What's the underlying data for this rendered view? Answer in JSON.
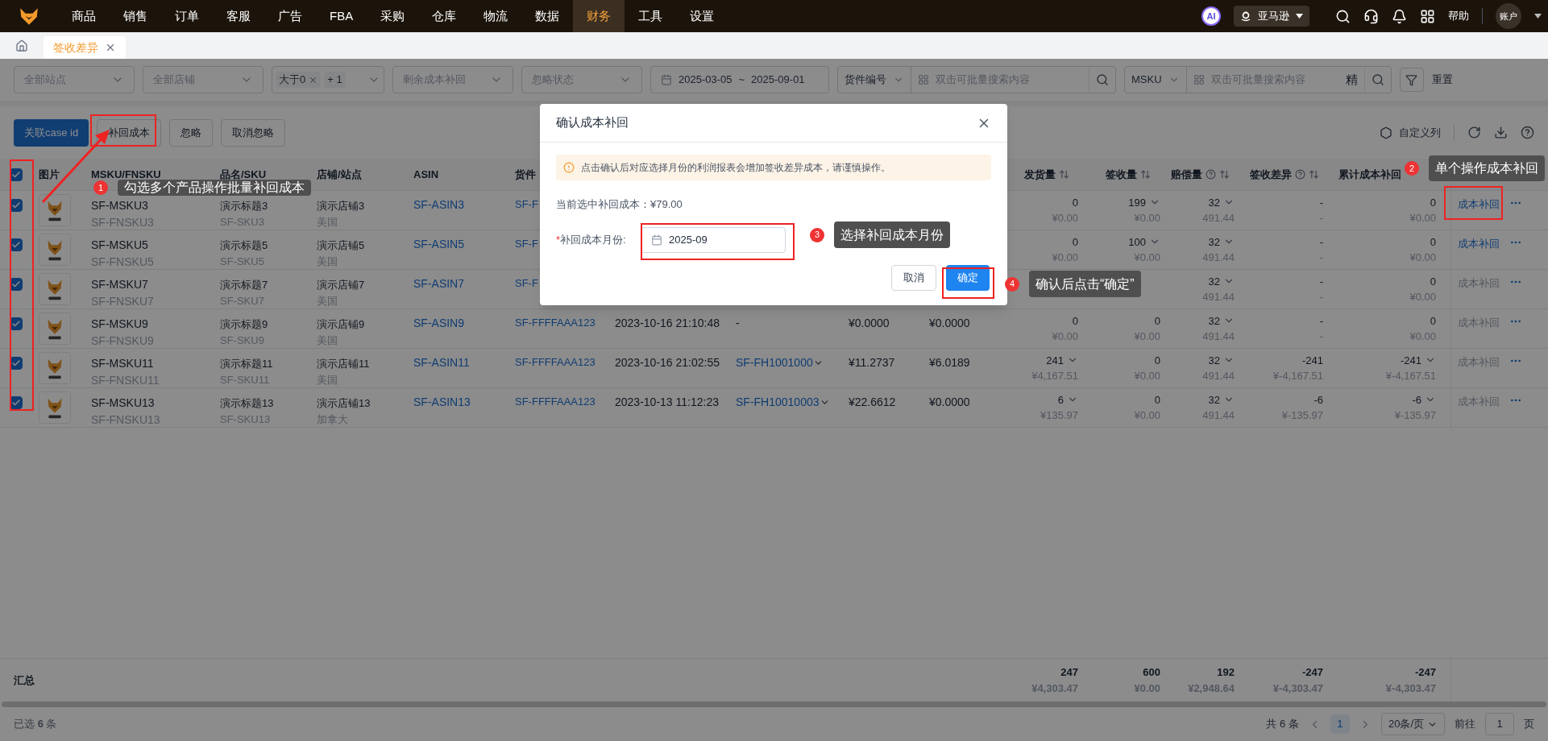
{
  "nav": {
    "items": [
      {
        "label": "商品",
        "selected": false
      },
      {
        "label": "销售",
        "selected": false
      },
      {
        "label": "订单",
        "selected": false
      },
      {
        "label": "客服",
        "selected": false
      },
      {
        "label": "广告",
        "selected": false
      },
      {
        "label": "FBA",
        "selected": false
      },
      {
        "label": "采购",
        "selected": false
      },
      {
        "label": "仓库",
        "selected": false
      },
      {
        "label": "物流",
        "selected": false
      },
      {
        "label": "数据",
        "selected": false
      },
      {
        "label": "财务",
        "selected": true
      },
      {
        "label": "工具",
        "selected": false
      },
      {
        "label": "设置",
        "selected": false
      }
    ],
    "ai_badge": "AI",
    "marketplace": "亚马逊",
    "help": "帮助",
    "account": "账户"
  },
  "tabs": [
    {
      "label": "签收差异",
      "selected": true
    }
  ],
  "filters": [
    {
      "kind": "select",
      "placeholder": "全部站点"
    },
    {
      "kind": "select",
      "placeholder": "全部店铺"
    },
    {
      "kind": "tags",
      "tags": [
        "大于0"
      ],
      "more": "+ 1"
    },
    {
      "kind": "select",
      "placeholder": "剩余成本补回"
    },
    {
      "kind": "select",
      "placeholder": "忽略状态"
    },
    {
      "kind": "daterange",
      "start": "2025-03-05",
      "separator": "~",
      "end": "2025-09-01"
    },
    {
      "kind": "search",
      "field": "货件编号",
      "placeholder": "双击可批量搜索内容"
    },
    {
      "kind": "search",
      "field": "MSKU",
      "placeholder": "双击可批量搜索内容",
      "exact": "精"
    }
  ],
  "reset": "重置",
  "toolbar": {
    "buttons": [
      {
        "label": "关联case id",
        "primary": true
      },
      {
        "label": "补回成本",
        "primary": false
      },
      {
        "label": "忽略",
        "primary": false
      },
      {
        "label": "取消忽略",
        "primary": false
      }
    ],
    "custom_columns": "自定义列"
  },
  "table": {
    "all_checked": true,
    "columns": [
      {
        "label": "图片"
      },
      {
        "label": "MSKU/FNSKU"
      },
      {
        "label": "品名/SKU"
      },
      {
        "label": "店铺/站点"
      },
      {
        "label": "ASIN"
      },
      {
        "label": "货件"
      }
    ],
    "number_columns": [
      {
        "label": "发货量",
        "icons": [
          {
            "kind": "sort"
          }
        ]
      },
      {
        "label": "签收量",
        "icons": [
          {
            "kind": "sort"
          }
        ]
      },
      {
        "label": "赔偿量",
        "icons": [
          {
            "kind": "help"
          },
          {
            "kind": "sort"
          }
        ]
      },
      {
        "label": "签收差异",
        "icons": [
          {
            "kind": "help"
          },
          {
            "kind": "sort"
          }
        ]
      },
      {
        "label": "累计成本补回"
      }
    ],
    "rows": [
      {
        "checked": true,
        "msku": "SF-MSKU3",
        "fnsku": "SF-FNSKU3",
        "title": "演示标题3",
        "sku": "SF-SKU3",
        "store": "演示店铺3",
        "site": "美国",
        "asin": "SF-ASIN3",
        "shipment_no": "SF-F",
        "shipped": {
          "value": "0",
          "amount": "¥0.00",
          "expandable": false
        },
        "received": {
          "value": "199",
          "amount": "¥0.00",
          "expandable": true
        },
        "compensation": {
          "value": "32",
          "amount": "491.44",
          "expandable": true
        },
        "difference": {
          "value": "-",
          "amount": "-",
          "expandable": false
        },
        "recovered": {
          "value": "0",
          "amount": "¥0.00",
          "expandable": false
        },
        "action": {
          "label": "成本补回",
          "disabled": false
        }
      },
      {
        "checked": true,
        "msku": "SF-MSKU5",
        "fnsku": "SF-FNSKU5",
        "title": "演示标题5",
        "sku": "SF-SKU5",
        "store": "演示店铺5",
        "site": "美国",
        "asin": "SF-ASIN5",
        "shipment_no": "SF-F",
        "shipped": {
          "value": "0",
          "amount": "¥0.00",
          "expandable": false
        },
        "received": {
          "value": "100",
          "amount": "¥0.00",
          "expandable": true
        },
        "compensation": {
          "value": "32",
          "amount": "491.44",
          "expandable": true
        },
        "difference": {
          "value": "-",
          "amount": "-",
          "expandable": false
        },
        "recovered": {
          "value": "0",
          "amount": "¥0.00",
          "expandable": false
        },
        "action": {
          "label": "成本补回",
          "disabled": false
        }
      },
      {
        "checked": true,
        "msku": "SF-MSKU7",
        "fnsku": "SF-FNSKU7",
        "title": "演示标题7",
        "sku": "SF-SKU7",
        "store": "演示店铺7",
        "site": "美国",
        "asin": "SF-ASIN7",
        "shipment_no": "SF-F",
        "compensation": {
          "value": "32",
          "amount": "491.44",
          "expandable": true
        },
        "difference": {
          "value": "-",
          "amount": "-",
          "expandable": false
        },
        "recovered": {
          "value": "0",
          "amount": "¥0.00",
          "expandable": false
        },
        "action": {
          "label": "成本补回",
          "disabled": true
        }
      },
      {
        "checked": true,
        "msku": "SF-MSKU9",
        "fnsku": "SF-FNSKU9",
        "title": "演示标题9",
        "sku": "SF-SKU9",
        "store": "演示店铺9",
        "site": "美国",
        "asin": "SF-ASIN9",
        "shipment_no": "SF-FFFFAAA123",
        "date": "2023-10-16 21:10:48",
        "shipment_id": {
          "text": "-",
          "expandable": false
        },
        "price_1": "¥0.0000",
        "price_2": "¥0.0000",
        "shipped": {
          "value": "0",
          "amount": "¥0.00",
          "expandable": false
        },
        "received": {
          "value": "0",
          "amount": "¥0.00",
          "expandable": false
        },
        "compensation": {
          "value": "32",
          "amount": "491.44",
          "expandable": true
        },
        "difference": {
          "value": "-",
          "amount": "-",
          "expandable": false
        },
        "recovered": {
          "value": "0",
          "amount": "¥0.00",
          "expandable": false
        },
        "action": {
          "label": "成本补回",
          "disabled": true
        }
      },
      {
        "checked": true,
        "msku": "SF-MSKU11",
        "fnsku": "SF-FNSKU11",
        "title": "演示标题11",
        "sku": "SF-SKU11",
        "store": "演示店铺11",
        "site": "美国",
        "asin": "SF-ASIN11",
        "shipment_no": "SF-FFFFAAA123",
        "date": "2023-10-16 21:02:55",
        "shipment_id": {
          "text": "SF-FH1001000",
          "expandable": true
        },
        "price_1": "¥11.2737",
        "price_2": "¥6.0189",
        "shipped": {
          "value": "241",
          "amount": "¥4,167.51",
          "expandable": true
        },
        "received": {
          "value": "0",
          "amount": "¥0.00",
          "expandable": false
        },
        "compensation": {
          "value": "32",
          "amount": "491.44",
          "expandable": true
        },
        "difference": {
          "value": "-241",
          "amount": "¥-4,167.51",
          "expandable": false
        },
        "recovered": {
          "value": "-241",
          "amount": "¥-4,167.51",
          "expandable": true
        },
        "action": {
          "label": "成本补回",
          "disabled": true
        }
      },
      {
        "checked": true,
        "msku": "SF-MSKU13",
        "fnsku": "SF-FNSKU13",
        "title": "演示标题13",
        "sku": "SF-SKU13",
        "store": "演示店铺13",
        "site": "加拿大",
        "asin": "SF-ASIN13",
        "shipment_no": "SF-FFFFAAA123",
        "date": "2023-10-13 11:12:23",
        "shipment_id": {
          "text": "SF-FH10010003",
          "expandable": true
        },
        "price_1": "¥22.6612",
        "price_2": "¥0.0000",
        "shipped": {
          "value": "6",
          "amount": "¥135.97",
          "expandable": true
        },
        "received": {
          "value": "0",
          "amount": "¥0.00",
          "expandable": false
        },
        "compensation": {
          "value": "32",
          "amount": "491.44",
          "expandable": true
        },
        "difference": {
          "value": "-6",
          "amount": "¥-135.97",
          "expandable": false
        },
        "recovered": {
          "value": "-6",
          "amount": "¥-135.97",
          "expandable": true
        },
        "action": {
          "label": "成本补回",
          "disabled": true
        }
      }
    ],
    "summary": {
      "label": "汇总",
      "cells": [
        {
          "value": "247",
          "amount": "¥4,303.47"
        },
        {
          "value": "600",
          "amount": "¥0.00"
        },
        {
          "value": "192",
          "amount": "¥2,948.64"
        },
        {
          "value": "-247",
          "amount": "¥-4,303.47"
        },
        {
          "value": "-247",
          "amount": "¥-4,303.47"
        }
      ]
    }
  },
  "footer": {
    "selected": "已选 **6** 条",
    "total": "共 6 条",
    "page": "1",
    "page_size": "20条/页",
    "goto": "前往",
    "goto_value": "1",
    "page_suffix": "页"
  },
  "modal": {
    "title": "确认成本补回",
    "notice": "点击确认后对应选择月份的利润报表会增加签收差异成本，请谨慎操作。",
    "current": "当前选中补回成本：¥79.00",
    "required_mark": "*",
    "field_label": "补回成本月份:",
    "field_value": "2025-09",
    "cancel": "取消",
    "confirm": "确定"
  },
  "annotations": [
    {
      "number": "1",
      "text": "勾选多个产品操作批量补回成本"
    },
    {
      "number": "2",
      "text": "单个操作成本补回"
    },
    {
      "number": "3",
      "text": "选择补回成本月份"
    },
    {
      "number": "4",
      "text": "确认后点击“确定”"
    }
  ]
}
